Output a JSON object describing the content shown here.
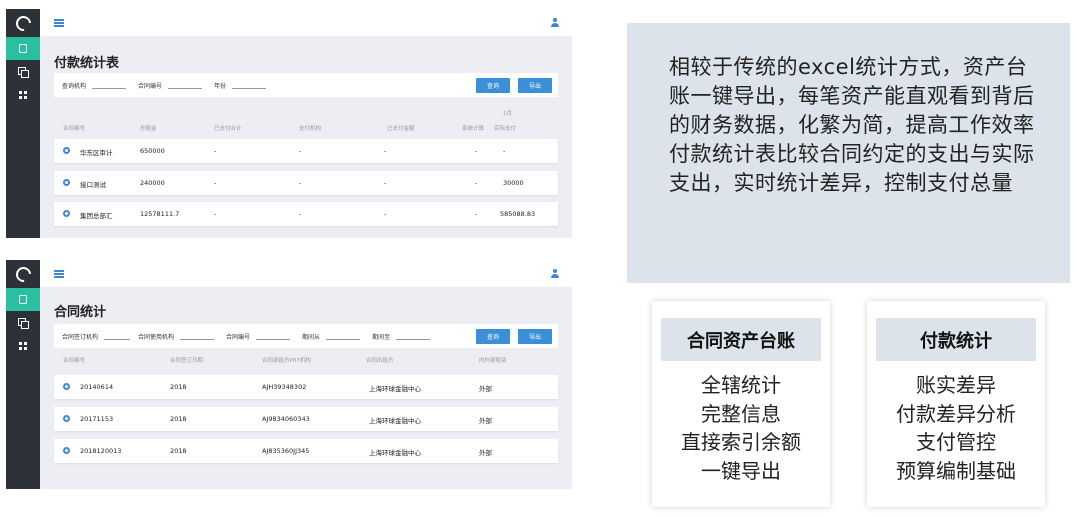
{
  "screen1": {
    "title": "付款统计表",
    "filters": [
      "查询机构",
      "合同编号",
      "年份"
    ],
    "buttons": {
      "search": "查询",
      "export": "导出"
    },
    "month_label": "1月",
    "columns": [
      "合同编号",
      "总租金",
      "已支付合计",
      "支付机构",
      "已支付金额",
      "系统计算",
      "实际支付"
    ],
    "rows": [
      [
        "华东区审计",
        "650000",
        "-",
        "-",
        "-",
        "-",
        "-"
      ],
      [
        "接口测试",
        "240000",
        "-",
        "-",
        "-",
        "-",
        "30000"
      ],
      [
        "集团总部汇",
        "12578111.7",
        "-",
        "-",
        "-",
        "-",
        "585088.83"
      ]
    ]
  },
  "screen2": {
    "title": "合同统计",
    "filters": [
      "合同签订机构",
      "合同使用机构",
      "合同编号",
      "期间从",
      "期间至"
    ],
    "buttons": {
      "search": "查询",
      "export": "导出"
    },
    "columns": [
      "合同编号",
      "合同签订日期",
      "合同承租方P07机构",
      "合同出租方",
      "内外部租赁"
    ],
    "rows": [
      [
        "20140614",
        "2018",
        "AJH39348302",
        "上海环球金融中心",
        "外部"
      ],
      [
        "20171153",
        "2018",
        "AJ9834060343",
        "上海环球金融中心",
        "外部"
      ],
      [
        "2018120013",
        "2018",
        "AJ835360JJ345",
        "上海环球金融中心",
        "外部"
      ]
    ]
  },
  "description": {
    "p1": "相较于传统的excel统计方式，资产台账一键导出，每笔资产能直观看到背后的财务数据，化繁为简，提高工作效率",
    "p2": "付款统计表比较合同约定的支出与实际支出，实时统计差异，控制支付总量"
  },
  "card1": {
    "title": "合同资产台账",
    "items": [
      "全辖统计",
      "完整信息",
      "直接索引余额",
      "一键导出"
    ]
  },
  "card2": {
    "title": "付款统计",
    "items": [
      "账实差异",
      "付款差异分析",
      "支付管控",
      "预算编制基础"
    ]
  },
  "colors": {
    "sidebar": "#2d3239",
    "sidebar_active": "#2bbfa1",
    "accent": "#3b8fd6",
    "panel": "#dde3ea"
  }
}
